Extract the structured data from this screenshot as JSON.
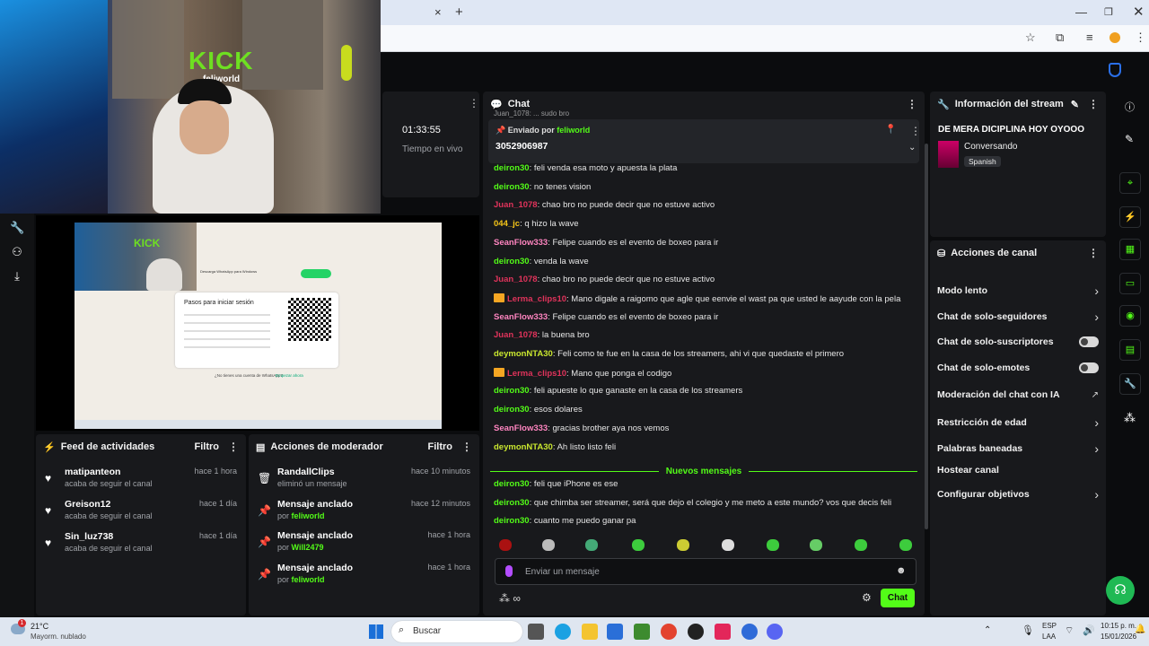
{
  "browser": {
    "new_tab": "+",
    "close_tab": "×"
  },
  "stream": {
    "duration": "01:33:55",
    "duration_label": "Tiempo en vivo"
  },
  "cam_logo": {
    "brand": "KICK",
    "handle": "feliworld"
  },
  "pinned": {
    "sent_by_label": "Enviado por",
    "sender": "feliworld",
    "message": "3052906987"
  },
  "chat": {
    "title": "Chat",
    "top_partial": "Juan_1078: ... sudo bro",
    "messages": [
      {
        "user": "deiron30",
        "color": "g",
        "text": "feli venda esa moto y apuesta la plata",
        "crown": false
      },
      {
        "user": "deiron30",
        "color": "g",
        "text": "no tenes vision",
        "crown": false
      },
      {
        "user": "Juan_1078",
        "color": "r",
        "text": "chao bro no puede decir que no estuve activo",
        "crown": false
      },
      {
        "user": "044_jc",
        "color": "y",
        "text": "q hizo la wave",
        "crown": false
      },
      {
        "user": "SeanFlow333",
        "color": "p",
        "text": "Felipe cuando es el evento de boxeo para ir",
        "crown": false
      },
      {
        "user": "deiron30",
        "color": "g",
        "text": "venda la wave",
        "crown": false
      },
      {
        "user": "Juan_1078",
        "color": "r",
        "text": "chao bro no puede decir que no estuve activo",
        "crown": false
      },
      {
        "user": "Lerma_clips10",
        "color": "r",
        "text": "Mano digale a raigomo que agle que eenvie el wast pa que usted le aayude con la pela",
        "crown": true
      },
      {
        "user": "SeanFlow333",
        "color": "p",
        "text": "Felipe cuando es el evento de boxeo para ir",
        "crown": false
      },
      {
        "user": "Juan_1078",
        "color": "r",
        "text": "la buena bro",
        "crown": false
      },
      {
        "user": "deymonNTA30",
        "color": "t",
        "text": "Feli como te fue en la casa de los streamers, ahi vi que quedaste el primero",
        "crown": false
      },
      {
        "user": "Lerma_clips10",
        "color": "r",
        "text": "Mano que ponga el codigo",
        "crown": true
      },
      {
        "user": "deiron30",
        "color": "g",
        "text": "feli apueste lo que ganaste en la casa de los streamers",
        "crown": false
      },
      {
        "user": "deiron30",
        "color": "g",
        "text": "esos dolares",
        "crown": false
      },
      {
        "user": "SeanFlow333",
        "color": "p",
        "text": "gracias brother aya nos vemos",
        "crown": false
      },
      {
        "user": "deymonNTA30",
        "color": "t",
        "text": "Ah listo listo feli",
        "crown": false
      }
    ],
    "new_messages_label": "Nuevos mensajes",
    "new_messages": [
      {
        "user": "deiron30",
        "color": "g",
        "text": "feli que iPhone es ese"
      },
      {
        "user": "deiron30",
        "color": "g",
        "text": "que chimba ser streamer, será que dejo el colegio y me meto a este mundo? vos que decis feli"
      },
      {
        "user": "deiron30",
        "color": "g",
        "text": "cuanto me puedo ganar pa"
      }
    ],
    "input_placeholder": "Enviar un mensaje",
    "send_label": "Chat"
  },
  "stream_info": {
    "title": "Información del stream",
    "stream_title": "DE MERA DICIPLINA HOY OYOOO",
    "category": "Conversando",
    "language": "Spanish"
  },
  "channel_actions": {
    "title": "Acciones de canal",
    "items": [
      {
        "label": "Modo lento",
        "kind": "chevron"
      },
      {
        "label": "Chat de solo-seguidores",
        "kind": "chevron"
      },
      {
        "label": "Chat de solo-suscriptores",
        "kind": "toggle"
      },
      {
        "label": "Chat de solo-emotes",
        "kind": "toggle"
      },
      {
        "label": "Moderación del chat con IA",
        "kind": "external"
      },
      {
        "label": "Restricción de edad",
        "kind": "chevron"
      },
      {
        "label": "Palabras baneadas",
        "kind": "chevron"
      },
      {
        "label": "Hostear canal",
        "kind": "none"
      },
      {
        "label": "Configurar objetivos",
        "kind": "chevron"
      }
    ]
  },
  "activity_feed": {
    "title": "Feed de actividades",
    "filter": "Filtro",
    "items": [
      {
        "name": "matipanteon",
        "sub": "acaba de seguir el canal",
        "time": "hace 1 hora"
      },
      {
        "name": "Greison12",
        "sub": "acaba de seguir el canal",
        "time": "hace 1 día"
      },
      {
        "name": "Sin_luz738",
        "sub": "acaba de seguir el canal",
        "time": "hace 1 día"
      }
    ]
  },
  "mod_actions": {
    "title": "Acciones de moderador",
    "filter": "Filtro",
    "items": [
      {
        "name": "RandallClips",
        "sub_prefix": "eliminó un mensaje",
        "sub_user": "",
        "time": "hace 10 minutos",
        "icon": "trash-icon"
      },
      {
        "name": "Mensaje anclado",
        "sub_prefix": "por",
        "sub_user": "feliworld",
        "time": "hace 12 minutos",
        "icon": "pin-icon"
      },
      {
        "name": "Mensaje anclado",
        "sub_prefix": "por",
        "sub_user": "Will2479",
        "time": "hace 1 hora",
        "icon": "pin-icon"
      },
      {
        "name": "Mensaje anclado",
        "sub_prefix": "por",
        "sub_user": "feliworld",
        "time": "hace 1 hora",
        "icon": "pin-icon"
      }
    ]
  },
  "screen_share": {
    "download_title": "Descarga WhatsApp para Windows",
    "steps_title": "Pasos para iniciar sesión",
    "no_account": "¿No tienes una cuenta de WhatsApp?",
    "start_link": "Empezar ahora"
  },
  "taskbar": {
    "temp": "21°C",
    "weather": "Mayorm. nublado",
    "search": "Buscar",
    "lang1": "ESP",
    "lang2": "LAA",
    "time": "10:15 p. m.",
    "date": "15/01/2026",
    "badge": "1"
  },
  "colors": {
    "accent": "#53fc18",
    "panel": "#18191c",
    "bg": "#0b0c0e"
  }
}
